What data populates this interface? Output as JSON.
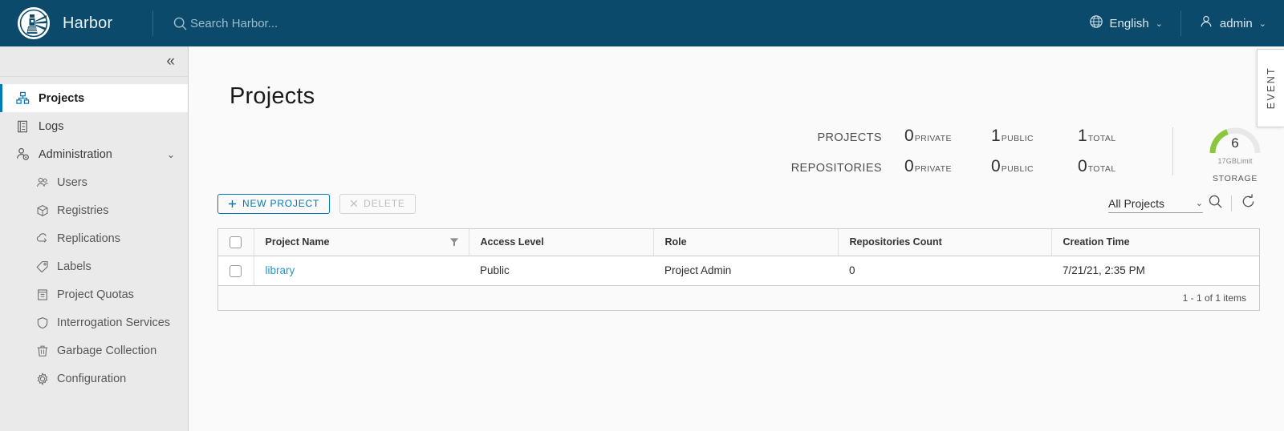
{
  "header": {
    "brand": "Harbor",
    "logo_icon": "harbor-lighthouse-logo",
    "search": {
      "placeholder": "Search Harbor...",
      "value": "",
      "icon": "search-icon"
    },
    "language": {
      "label": "English",
      "icon": "globe-icon",
      "caret": "⌄"
    },
    "user": {
      "label": "admin",
      "icon": "user-icon",
      "caret": "⌄"
    }
  },
  "sidebar": {
    "collapse_icon": "«",
    "items": [
      {
        "label": "Projects",
        "icon": "projects-icon",
        "active": true
      },
      {
        "label": "Logs",
        "icon": "logs-icon",
        "active": false
      },
      {
        "label": "Administration",
        "icon": "administration-icon",
        "active": false,
        "expanded": true,
        "chevron": "⌄"
      }
    ],
    "sub_items": [
      {
        "label": "Users",
        "icon": "users-icon"
      },
      {
        "label": "Registries",
        "icon": "registries-icon"
      },
      {
        "label": "Replications",
        "icon": "replications-icon"
      },
      {
        "label": "Labels",
        "icon": "labels-icon"
      },
      {
        "label": "Project Quotas",
        "icon": "project-quotas-icon"
      },
      {
        "label": "Interrogation Services",
        "icon": "interrogation-services-icon"
      },
      {
        "label": "Garbage Collection",
        "icon": "garbage-collection-icon"
      },
      {
        "label": "Configuration",
        "icon": "configuration-icon"
      }
    ]
  },
  "page": {
    "title": "Projects"
  },
  "statistics": {
    "rows": [
      {
        "label": "PROJECTS",
        "cells": [
          {
            "value": "0",
            "unit": "PRIVATE"
          },
          {
            "value": "1",
            "unit": "PUBLIC"
          },
          {
            "value": "1",
            "unit": "TOTAL"
          }
        ]
      },
      {
        "label": "REPOSITORIES",
        "cells": [
          {
            "value": "0",
            "unit": "PRIVATE"
          },
          {
            "value": "0",
            "unit": "PUBLIC"
          },
          {
            "value": "0",
            "unit": "TOTAL"
          }
        ]
      }
    ],
    "storage": {
      "value": "6",
      "limit": "17GBLimit",
      "caption": "STORAGE",
      "percent": 35,
      "arc_color": "#8cc63e",
      "track_color": "#e8e8e8"
    }
  },
  "toolbar": {
    "new_project": {
      "label": "NEW PROJECT",
      "icon": "plus-icon"
    },
    "delete": {
      "label": "DELETE",
      "icon": "close-x-icon",
      "disabled": true
    },
    "filter_select": {
      "value": "All Projects",
      "caret": "⌄"
    },
    "search_icon": "search-icon",
    "refresh_icon": "refresh-icon"
  },
  "table": {
    "columns": [
      "Project Name",
      "Access Level",
      "Role",
      "Repositories Count",
      "Creation Time"
    ],
    "rows": [
      {
        "project_name": "library",
        "access_level": "Public",
        "role": "Project Admin",
        "repositories_count": "0",
        "creation_time": "7/21/21, 2:35 PM"
      }
    ],
    "footer": "1 - 1 of 1 items"
  },
  "event_tab": {
    "label": "EVENT"
  },
  "colors": {
    "header_bg": "#0b4a6a",
    "sidebar_bg": "#eaeaea",
    "content_bg": "#fafafa",
    "accent": "#0079b8",
    "link": "#2193d0",
    "gauge_green": "#8cc63e"
  }
}
